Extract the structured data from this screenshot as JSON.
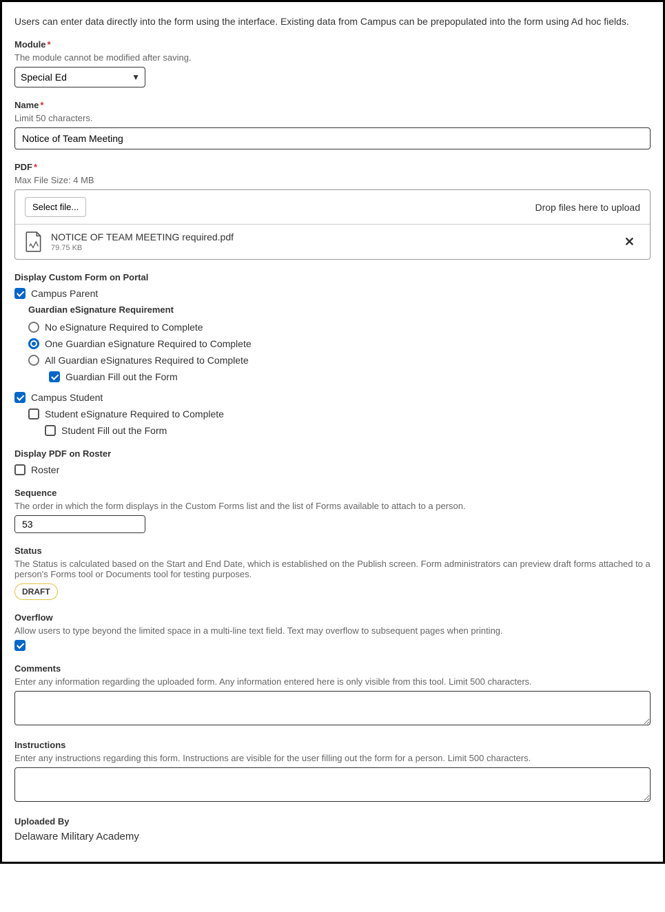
{
  "intro": "Users can enter data directly into the form using the interface. Existing data from Campus can be prepopulated into the form using Ad hoc fields.",
  "module": {
    "label": "Module",
    "helper": "The module cannot be modified after saving.",
    "value": "Special Ed"
  },
  "name": {
    "label": "Name",
    "helper": "Limit 50 characters.",
    "value": "Notice of Team Meeting"
  },
  "pdf": {
    "label": "PDF",
    "helper": "Max File Size: 4 MB",
    "selectFile": "Select file...",
    "dropHint": "Drop files here to upload",
    "fileName": "NOTICE OF TEAM MEETING required.pdf",
    "fileSize": "79.75 KB"
  },
  "portal": {
    "title": "Display Custom Form on Portal",
    "campusParent": "Campus Parent",
    "guardianTitle": "Guardian eSignature Requirement",
    "opt1": "No eSignature Required to Complete",
    "opt2": "One Guardian eSignature Required to Complete",
    "opt3": "All Guardian eSignatures Required to Complete",
    "guardianFill": "Guardian Fill out the Form",
    "campusStudent": "Campus Student",
    "studentEsig": "Student eSignature Required to Complete",
    "studentFill": "Student Fill out the Form"
  },
  "roster": {
    "title": "Display PDF on Roster",
    "label": "Roster"
  },
  "sequence": {
    "label": "Sequence",
    "helper": "The order in which the form displays in the Custom Forms list and the list of Forms available to attach to a person.",
    "value": "53"
  },
  "status": {
    "label": "Status",
    "helper": "The Status is calculated based on the Start and End Date, which is established on the Publish screen. Form administrators can preview draft forms attached to a person's Forms tool or Documents tool for testing purposes.",
    "badge": "DRAFT"
  },
  "overflow": {
    "label": "Overflow",
    "helper": "Allow users to type beyond the limited space in a multi-line text field. Text may overflow to subsequent pages when printing."
  },
  "comments": {
    "label": "Comments",
    "helper": "Enter any information regarding the uploaded form. Any information entered here is only visible from this tool. Limit 500 characters."
  },
  "instructions": {
    "label": "Instructions",
    "helper": "Enter any instructions regarding this form. Instructions are visible for the user filling out the form for a person. Limit 500 characters."
  },
  "uploadedBy": {
    "label": "Uploaded By",
    "value": "Delaware Military Academy"
  }
}
